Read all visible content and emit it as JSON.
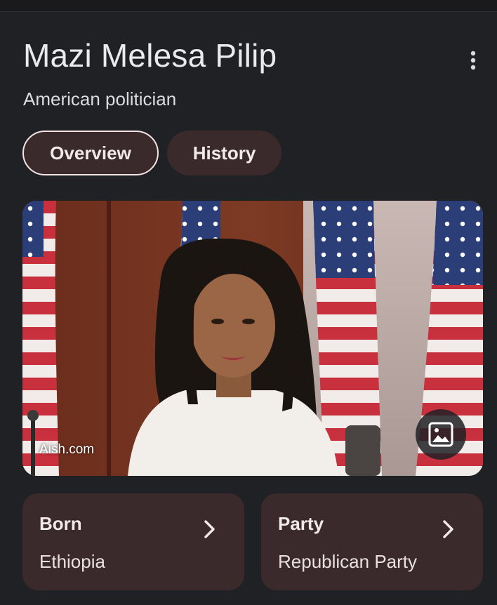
{
  "entity": {
    "name": "Mazi Melesa Pilip",
    "description": "American politician"
  },
  "tabs": [
    {
      "label": "Overview",
      "selected": true
    },
    {
      "label": "History",
      "selected": false
    }
  ],
  "image": {
    "source": "Aish.com",
    "button_icon": "image-icon"
  },
  "facts": [
    {
      "label": "Born",
      "value": "Ethiopia"
    },
    {
      "label": "Party",
      "value": "Republican Party"
    }
  ],
  "colors": {
    "background": "#202124",
    "chip_fill": "#3b2a2c",
    "chip_selected_border": "#f3e3e4",
    "text_primary": "#e8eaed"
  }
}
